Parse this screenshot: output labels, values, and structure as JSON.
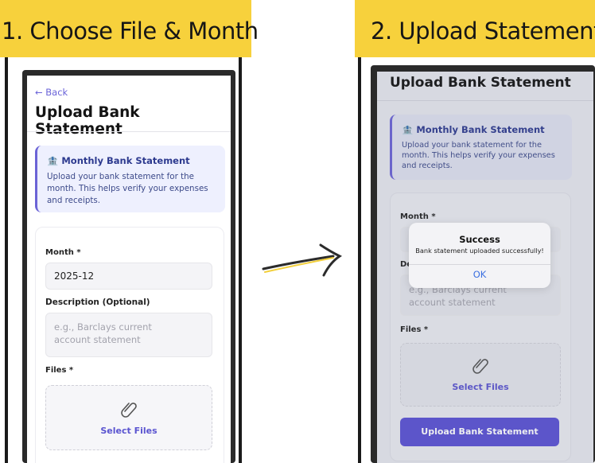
{
  "steps": {
    "step1_title": "1. Choose File & Month",
    "step2_title": "2. Upload Statement"
  },
  "screen_left": {
    "back_label": "← Back",
    "page_title": "Upload Bank Statement",
    "info": {
      "icon": "🏦",
      "title": "Monthly Bank Statement",
      "body": "Upload your bank statement for the month. This helps verify your expenses and receipts."
    },
    "month_label": "Month *",
    "month_value": "2025-12",
    "description_label": "Description (Optional)",
    "description_placeholder": "e.g., Barclays current account statement",
    "files_label": "Files *",
    "select_files_label": "Select Files"
  },
  "screen_right": {
    "page_title": "Upload Bank Statement",
    "info": {
      "icon": "🏦",
      "title": "Monthly Bank Statement",
      "body": "Upload your bank statement for the month. This helps verify your expenses and receipts."
    },
    "month_label": "Month *",
    "month_value_partial": "2",
    "description_label_partial": "De",
    "description_placeholder": "e.g., Barclays current account statement",
    "files_label": "Files *",
    "select_files_label": "Select Files",
    "upload_button_label": "Upload Bank Statement",
    "dialog": {
      "title": "Success",
      "message": "Bank statement uploaded successfully!",
      "ok_label": "OK"
    }
  },
  "colors": {
    "banner": "#f7d13c",
    "accent": "#5b51d4",
    "info_bg": "#eef0fe"
  }
}
